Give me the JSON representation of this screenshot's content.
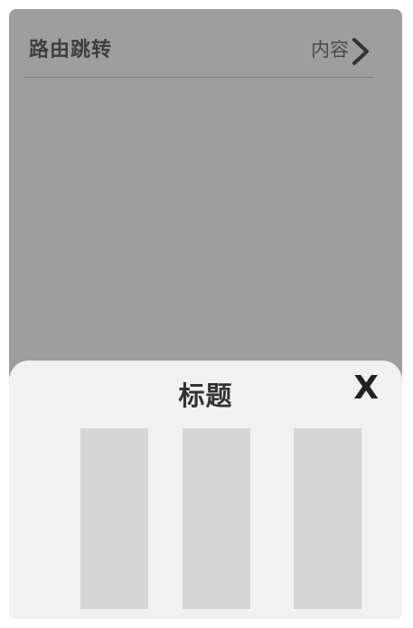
{
  "route_row": {
    "label": "路由跳转",
    "value": "内容",
    "chevron_icon": "chevron-right-icon"
  },
  "sheet": {
    "title": "标题",
    "close_label": "X",
    "columns": [
      {
        "name": "picker-column-1"
      },
      {
        "name": "picker-column-2"
      },
      {
        "name": "picker-column-3"
      }
    ]
  },
  "colors": {
    "overlay": "#9e9e9e",
    "sheet_background": "#f1f1f1",
    "column_fill": "#d6d6d6"
  }
}
